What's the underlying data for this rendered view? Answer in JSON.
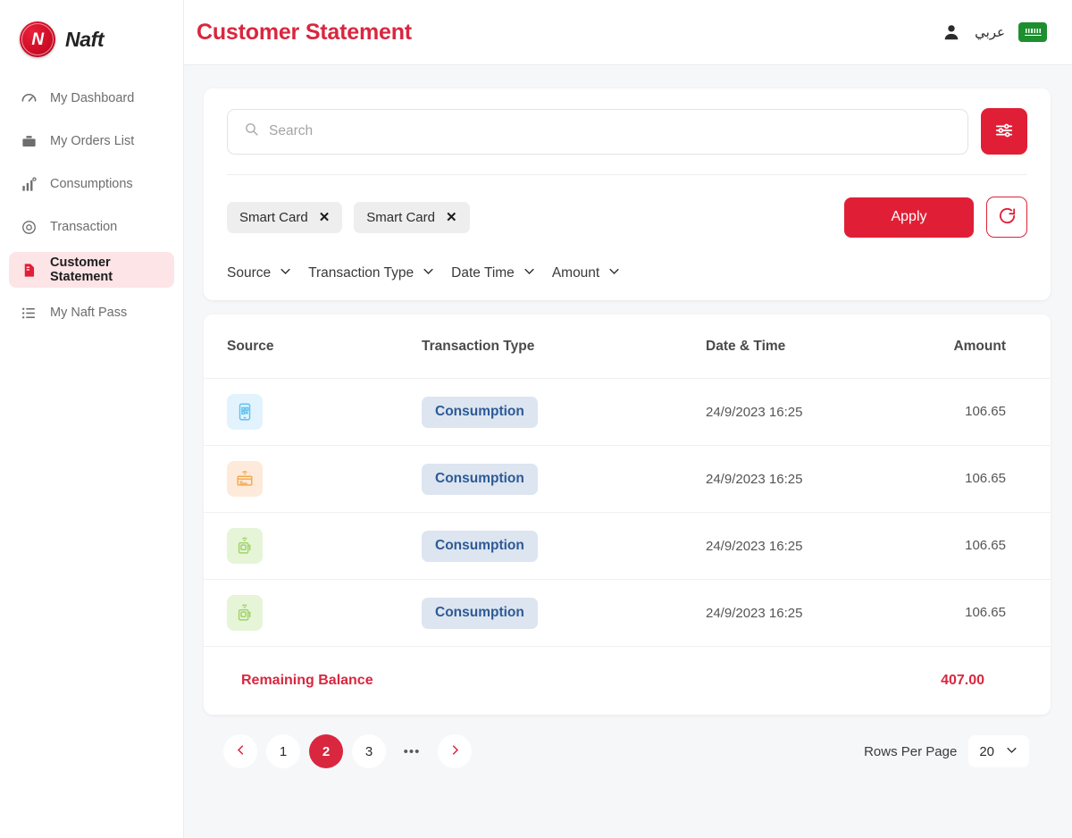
{
  "brand": {
    "name": "Naft",
    "mark_letter": "N",
    "accent": "#d8273f"
  },
  "sidebar": {
    "items": [
      {
        "label": "My Dashboard",
        "icon": "dashboard-icon",
        "active": false
      },
      {
        "label": "My Orders List",
        "icon": "briefcase-icon",
        "active": false
      },
      {
        "label": "Consumptions",
        "icon": "bar-chart-icon",
        "active": false
      },
      {
        "label": "Transaction",
        "icon": "transaction-refresh-icon",
        "active": false
      },
      {
        "label": "Customer Statement",
        "icon": "document-icon",
        "active": true
      },
      {
        "label": "My Naft Pass",
        "icon": "list-icon",
        "active": false
      }
    ]
  },
  "header": {
    "title": "Customer Statement",
    "user_icon": "user-icon",
    "language_label": "عربي",
    "flag_icon": "saudi-arabia-flag-icon"
  },
  "filters": {
    "search": {
      "value": "",
      "placeholder": "Search"
    },
    "filter_button_icon": "sliders-filter-icon",
    "chips": [
      {
        "label": "Smart Card",
        "remove_icon": "close-icon"
      },
      {
        "label": "Smart Card",
        "remove_icon": "close-icon"
      }
    ],
    "apply_label": "Apply",
    "reset_icon": "refresh-icon",
    "sorts": [
      {
        "label": "Source",
        "icon": "chevron-down-icon"
      },
      {
        "label": "Transaction Type",
        "icon": "chevron-down-icon"
      },
      {
        "label": "Date Time",
        "icon": "chevron-down-icon"
      },
      {
        "label": "Amount",
        "icon": "chevron-down-icon"
      }
    ]
  },
  "table": {
    "columns": [
      "Source",
      "Transaction Type",
      "Date  &  Time",
      "Amount"
    ],
    "rows": [
      {
        "source_icon": "mobile-qr-icon",
        "source_color": "blue",
        "type": "Consumption",
        "date": "24/9/2023 16:25",
        "amount": "106.65"
      },
      {
        "source_icon": "contactless-card-icon",
        "source_color": "orange",
        "type": "Consumption",
        "date": "24/9/2023 16:25",
        "amount": "106.65"
      },
      {
        "source_icon": "fuel-tag-nfc-icon",
        "source_color": "green",
        "type": "Consumption",
        "date": "24/9/2023 16:25",
        "amount": "106.65"
      },
      {
        "source_icon": "fuel-tag-nfc-icon",
        "source_color": "green",
        "type": "Consumption",
        "date": "24/9/2023 16:25",
        "amount": "106.65"
      }
    ],
    "balance_label": "Remaining Balance",
    "balance_amount": "407.00"
  },
  "pagination": {
    "prev_icon": "chevron-left-icon",
    "next_icon": "chevron-right-icon",
    "pages": [
      "1",
      "2",
      "3"
    ],
    "ellipsis": "•••",
    "current": "2",
    "rows_per_page_label": "Rows Per Page",
    "rows_per_page_value": "20",
    "rows_per_page_icon": "chevron-down-icon"
  }
}
